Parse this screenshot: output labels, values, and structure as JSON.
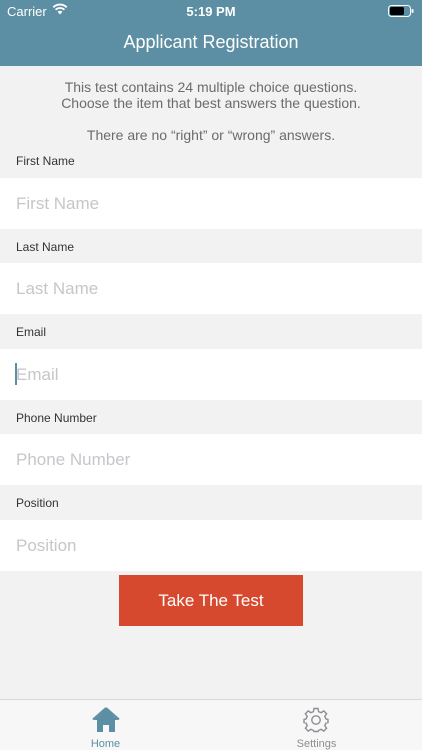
{
  "status_bar": {
    "carrier": "Carrier",
    "time": "5:19 PM"
  },
  "header": {
    "title": "Applicant Registration"
  },
  "intro": {
    "line1": "This test contains 24 multiple choice questions.",
    "line2": "Choose the item that best answers the question.",
    "line3": "There are no “right” or “wrong” answers."
  },
  "form": {
    "first_name": {
      "label": "First Name",
      "placeholder": "First Name",
      "value": ""
    },
    "last_name": {
      "label": "Last Name",
      "placeholder": "Last Name",
      "value": ""
    },
    "email": {
      "label": "Email",
      "placeholder": "Email",
      "value": ""
    },
    "phone": {
      "label": "Phone Number",
      "placeholder": "Phone Number",
      "value": ""
    },
    "position": {
      "label": "Position",
      "placeholder": "Position",
      "value": ""
    }
  },
  "take_test_button": "Take The Test",
  "tabs": [
    {
      "label": "Home",
      "icon": "home-icon",
      "active": true
    },
    {
      "label": "Settings",
      "icon": "gear-icon",
      "active": false
    }
  ],
  "colors": {
    "header": "#5c8fa3",
    "button": "#d6492e",
    "active_tab": "#5c8fa3"
  }
}
